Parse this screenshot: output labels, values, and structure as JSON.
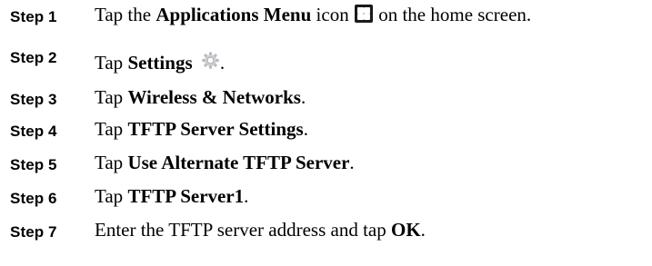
{
  "steps": [
    {
      "label": "Step 1",
      "parts": [
        {
          "t": "Tap the ",
          "b": false
        },
        {
          "t": "Applications Menu",
          "b": true
        },
        {
          "t": " icon ",
          "b": false
        },
        {
          "icon": "applications-menu-icon"
        },
        {
          "t": " on the home screen.",
          "b": false
        }
      ]
    },
    {
      "label": "Step 2",
      "parts": [
        {
          "t": "Tap ",
          "b": false
        },
        {
          "t": "Settings",
          "b": true
        },
        {
          "t": " ",
          "b": false
        },
        {
          "icon": "gear-icon"
        },
        {
          "t": ".",
          "b": false
        }
      ]
    },
    {
      "label": "Step 3",
      "parts": [
        {
          "t": "Tap ",
          "b": false
        },
        {
          "t": "Wireless & Networks",
          "b": true
        },
        {
          "t": ".",
          "b": false
        }
      ]
    },
    {
      "label": "Step 4",
      "parts": [
        {
          "t": "Tap ",
          "b": false
        },
        {
          "t": "TFTP Server Settings",
          "b": true
        },
        {
          "t": ".",
          "b": false
        }
      ]
    },
    {
      "label": "Step 5",
      "parts": [
        {
          "t": "Tap ",
          "b": false
        },
        {
          "t": "Use Alternate TFTP Server",
          "b": true
        },
        {
          "t": ".",
          "b": false
        }
      ]
    },
    {
      "label": "Step 6",
      "parts": [
        {
          "t": "Tap ",
          "b": false
        },
        {
          "t": "TFTP Server1",
          "b": true
        },
        {
          "t": ".",
          "b": false
        }
      ]
    },
    {
      "label": "Step 7",
      "parts": [
        {
          "t": "Enter the TFTP server address and tap ",
          "b": false
        },
        {
          "t": "OK",
          "b": true
        },
        {
          "t": ".",
          "b": false
        }
      ]
    }
  ],
  "colors": {
    "text": "#000000",
    "apps_icon_bg": "#1a1a1a",
    "gear_icon": "#b9bcc0"
  }
}
